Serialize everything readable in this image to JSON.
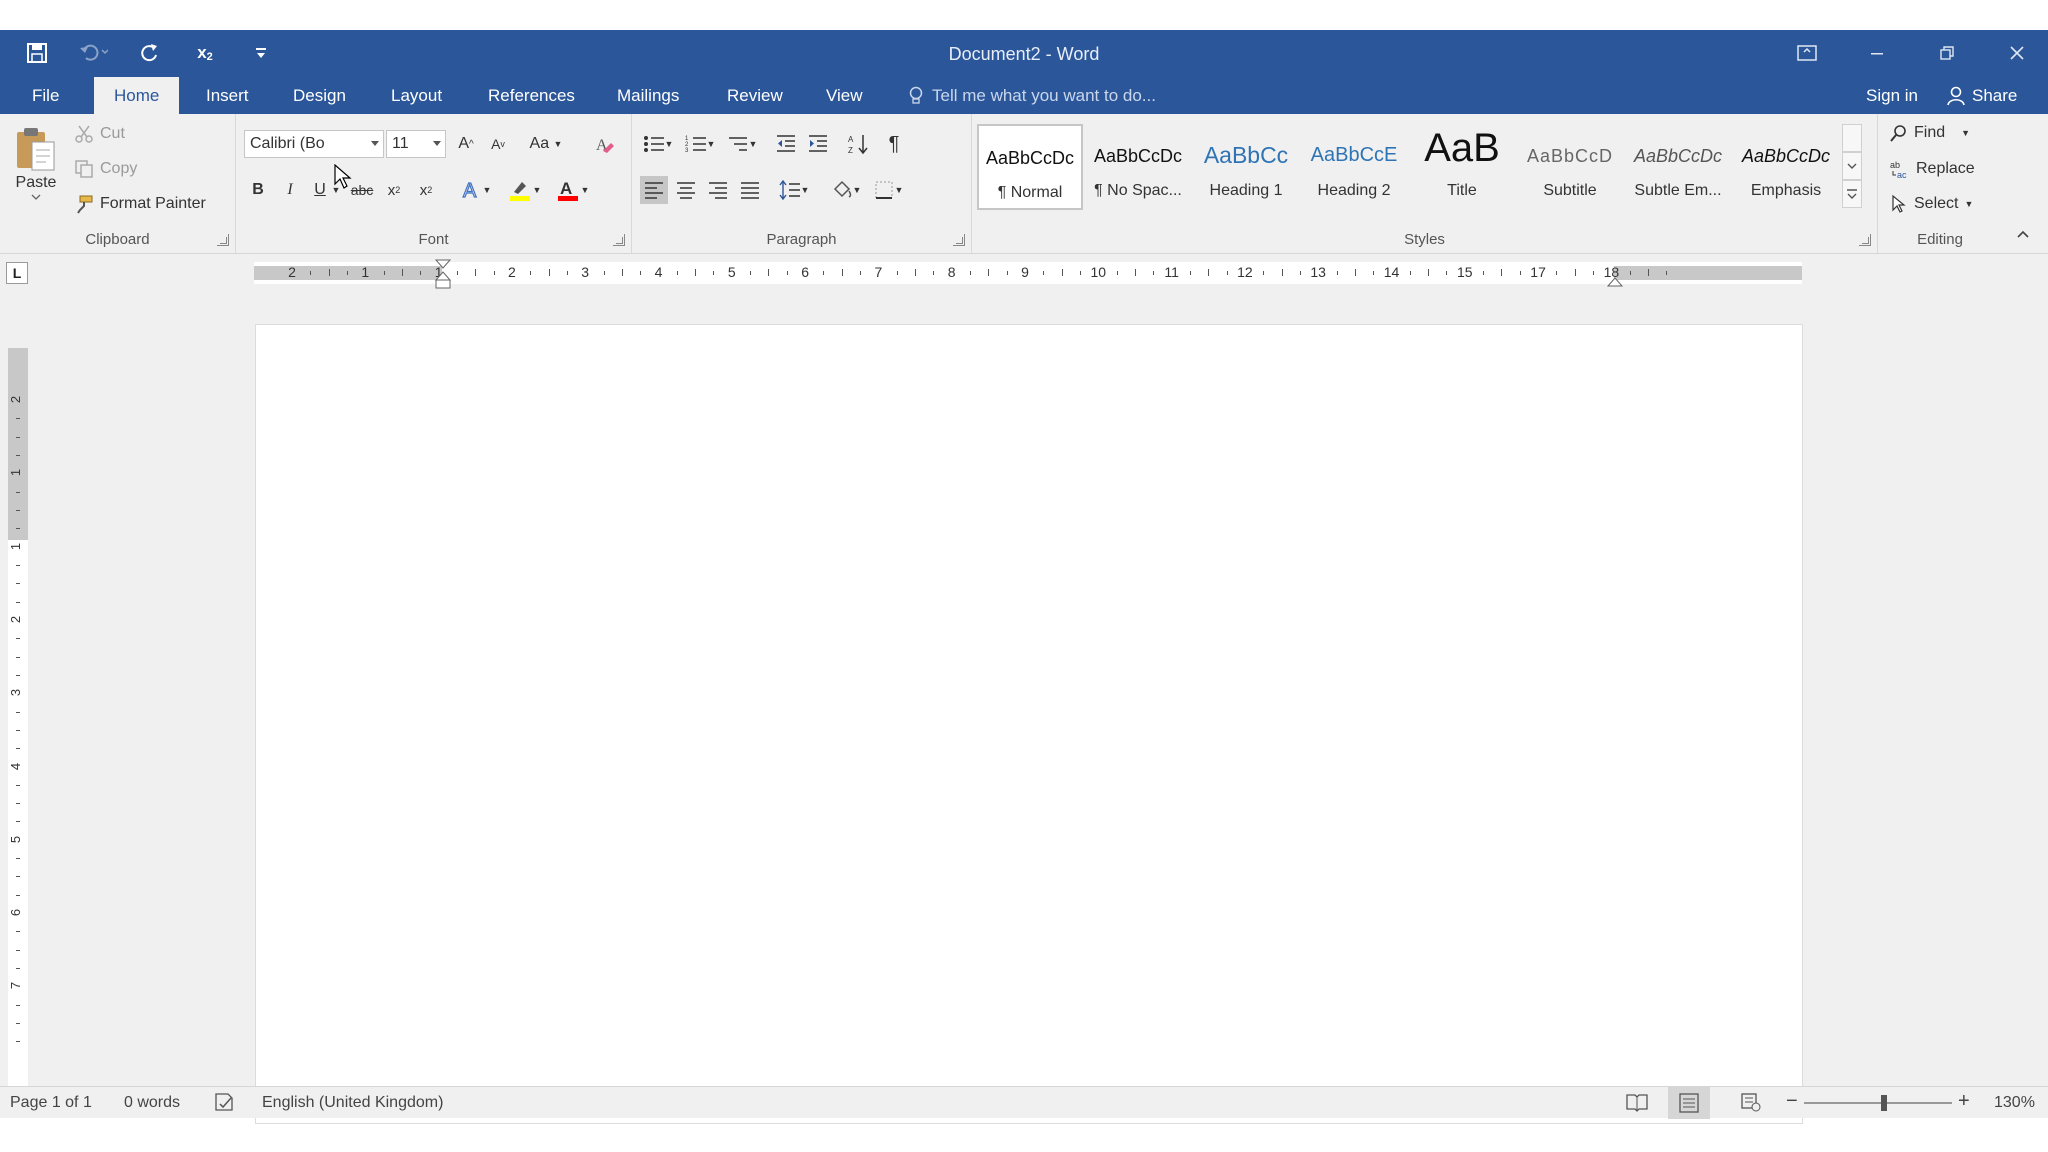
{
  "window": {
    "title": "Document2 - Word"
  },
  "tabs": [
    {
      "label": "File"
    },
    {
      "label": "Home"
    },
    {
      "label": "Insert"
    },
    {
      "label": "Design"
    },
    {
      "label": "Layout"
    },
    {
      "label": "References"
    },
    {
      "label": "Mailings"
    },
    {
      "label": "Review"
    },
    {
      "label": "View"
    }
  ],
  "tell_me": "Tell me what you want to do...",
  "account": {
    "sign_in": "Sign in",
    "share": "Share"
  },
  "clipboard": {
    "paste": "Paste",
    "cut": "Cut",
    "copy": "Copy",
    "format_painter": "Format Painter",
    "label": "Clipboard"
  },
  "font": {
    "name": "Calibri (Bo",
    "size": "11",
    "label": "Font",
    "change_case": "Aa"
  },
  "paragraph": {
    "label": "Paragraph"
  },
  "styles": {
    "label": "Styles",
    "items": [
      {
        "preview": "AaBbCcDc",
        "name": "¶ Normal"
      },
      {
        "preview": "AaBbCcDc",
        "name": "¶ No Spac..."
      },
      {
        "preview": "AaBbCc",
        "name": "Heading 1"
      },
      {
        "preview": "AaBbCcE",
        "name": "Heading 2"
      },
      {
        "preview": "AaB",
        "name": "Title"
      },
      {
        "preview": "AaBbCcD",
        "name": "Subtitle"
      },
      {
        "preview": "AaBbCcDc",
        "name": "Subtle Em..."
      },
      {
        "preview": "AaBbCcDc",
        "name": "Emphasis"
      }
    ]
  },
  "editing": {
    "label": "Editing",
    "find": "Find",
    "replace": "Replace",
    "select": "Select"
  },
  "ruler": {
    "h_numbers": [
      "2",
      "1",
      "1",
      "2",
      "3",
      "4",
      "5",
      "6",
      "7",
      "8",
      "9",
      "10",
      "11",
      "12",
      "13",
      "14",
      "15",
      "17",
      "18"
    ],
    "v_numbers": [
      "2",
      "1",
      "1",
      "2",
      "3",
      "4",
      "5",
      "6",
      "7"
    ]
  },
  "status": {
    "page": "Page 1 of 1",
    "words": "0 words",
    "language": "English (United Kingdom)",
    "zoom": "130%"
  },
  "colors": {
    "accent": "#2b579a",
    "highlight": "#ffff00",
    "font_color": "#ff0000"
  }
}
